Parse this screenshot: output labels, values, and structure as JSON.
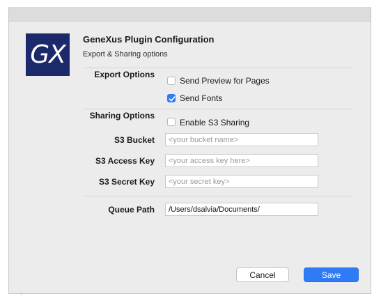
{
  "header": {
    "logo_text": "GX",
    "title": "GeneXus Plugin Configuration",
    "subtitle": "Export & Sharing options"
  },
  "export": {
    "label": "Export Options",
    "send_preview": {
      "label": "Send Preview for Pages",
      "checked": false
    },
    "send_fonts": {
      "label": "Send Fonts",
      "checked": true
    }
  },
  "sharing": {
    "label": "Sharing Options",
    "enable_s3": {
      "label": "Enable S3 Sharing",
      "checked": false
    },
    "s3_bucket": {
      "label": "S3 Bucket",
      "value": "",
      "placeholder": "<your bucket name>"
    },
    "s3_access_key": {
      "label": "S3 Access Key",
      "value": "",
      "placeholder": "<your access key here>"
    },
    "s3_secret_key": {
      "label": "S3 Secret Key",
      "value": "",
      "placeholder": "<your secret key>"
    }
  },
  "queue": {
    "label": "Queue Path",
    "value": "/Users/dsalvia/Documents/"
  },
  "buttons": {
    "cancel": "Cancel",
    "save": "Save"
  },
  "colors": {
    "accent": "#2f7bf6",
    "logo_bg": "#1c2a6b",
    "window_bg": "#ececec"
  }
}
